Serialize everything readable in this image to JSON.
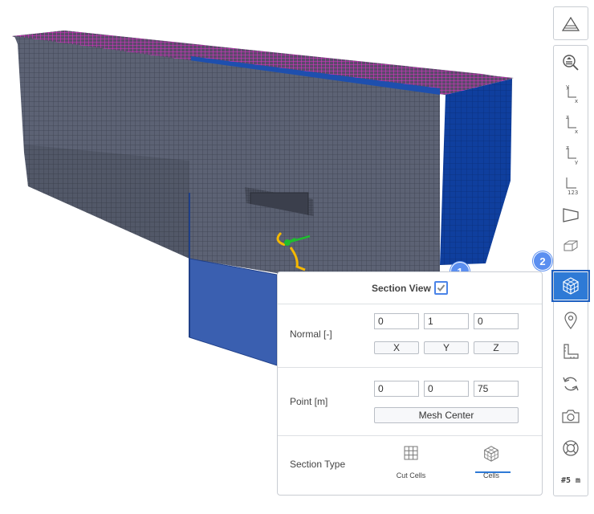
{
  "toolbar": {
    "top_button": "perspective-icon",
    "buttons": [
      {
        "name": "zoom-fit-icon"
      },
      {
        "name": "view-xy-icon",
        "axis_a": "y",
        "axis_b": "x"
      },
      {
        "name": "view-xz-icon",
        "axis_a": "z",
        "axis_b": "x"
      },
      {
        "name": "view-yz-icon",
        "axis_a": "z",
        "axis_b": "y"
      },
      {
        "name": "view-123-icon",
        "axis_b": "123"
      },
      {
        "name": "perspective-plane-icon"
      },
      {
        "name": "wireframe-box-icon"
      },
      {
        "name": "section-view-icon",
        "active": true
      },
      {
        "name": "location-pin-icon"
      },
      {
        "name": "ruler-icon"
      },
      {
        "name": "rotate-icon"
      },
      {
        "name": "camera-icon"
      },
      {
        "name": "lifebuoy-icon"
      }
    ],
    "scale_text": "#5 m"
  },
  "badges": {
    "one": "1",
    "two": "2"
  },
  "panel": {
    "title": "Section View",
    "checked": true,
    "normal_label": "Normal [-]",
    "normal_values": [
      "0",
      "1",
      "0"
    ],
    "axis_buttons": [
      "X",
      "Y",
      "Z"
    ],
    "point_label": "Point [m]",
    "point_values": [
      "0",
      "0",
      "75"
    ],
    "mesh_center": "Mesh Center",
    "section_type_label": "Section Type",
    "options": [
      {
        "label": "Cut Cells",
        "icon": "grid-icon",
        "selected": false
      },
      {
        "label": "Cells",
        "icon": "cube-mesh-icon",
        "selected": true
      }
    ]
  },
  "colors": {
    "accent": "#2e7ad6",
    "badge": "#5b8ff0",
    "mesh_gray": "#5c6274",
    "mesh_magenta": "#e030c8",
    "mesh_blue": "#0f3f9e"
  }
}
